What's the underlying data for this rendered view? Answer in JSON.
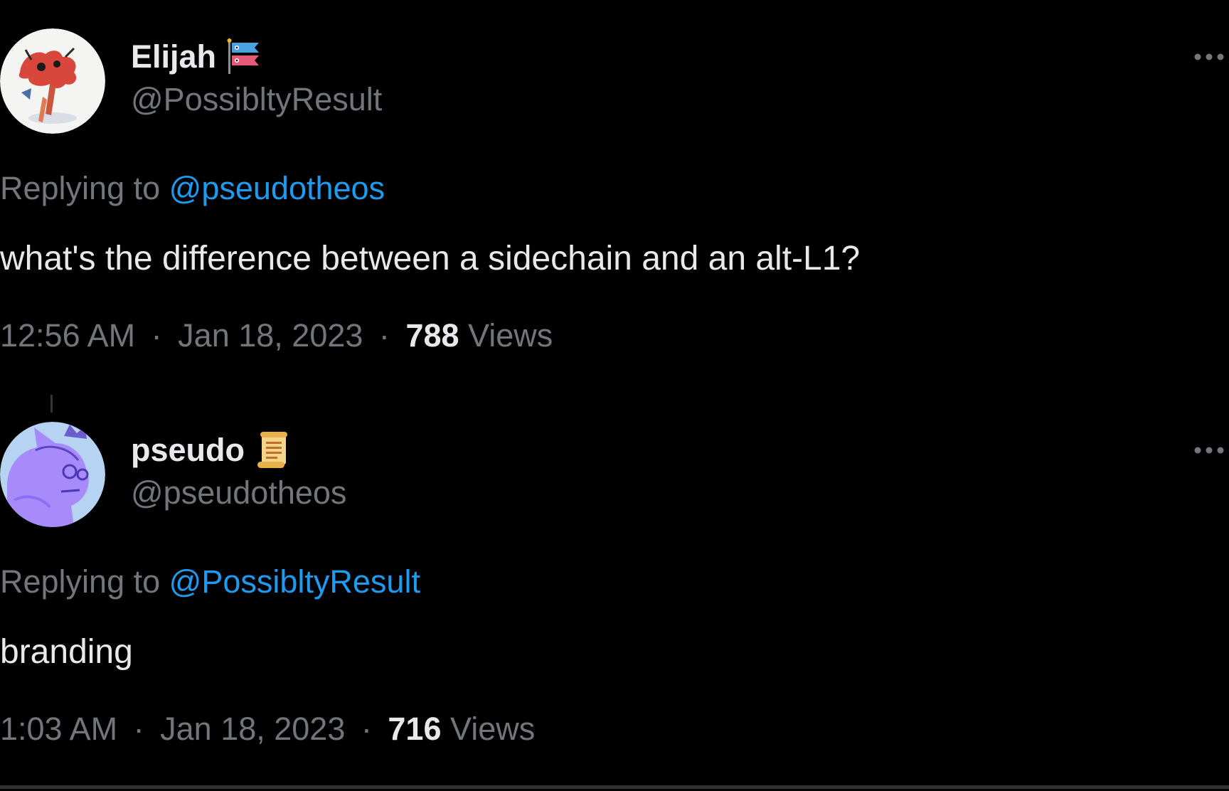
{
  "colors": {
    "background": "#000000",
    "text_primary": "#e7e9ea",
    "text_secondary": "#71767b",
    "accent_link": "#1d9bf0",
    "divider": "#2f3336"
  },
  "tweets": [
    {
      "display_name": "Elijah",
      "name_emoji": "carp-streamer-icon",
      "handle": "@PossibltyResult",
      "replying_prefix": "Replying to",
      "replying_to": "@pseudotheos",
      "text": "what's the difference between a sidechain and an alt-L1?",
      "time": "12:56 AM",
      "date": "Jan 18, 2023",
      "separator": "·",
      "views_count": "788",
      "views_label": "Views",
      "avatar_icon": "red-octopus-avatar",
      "more_icon": "more-options-icon"
    },
    {
      "display_name": "pseudo",
      "name_emoji": "scroll-icon",
      "handle": "@pseudotheos",
      "replying_prefix": "Replying to",
      "replying_to": "@PossibltyResult",
      "text": "branding",
      "time": "1:03 AM",
      "date": "Jan 18, 2023",
      "separator": "·",
      "views_count": "716",
      "views_label": "Views",
      "avatar_icon": "purple-cat-avatar",
      "more_icon": "more-options-icon"
    }
  ]
}
